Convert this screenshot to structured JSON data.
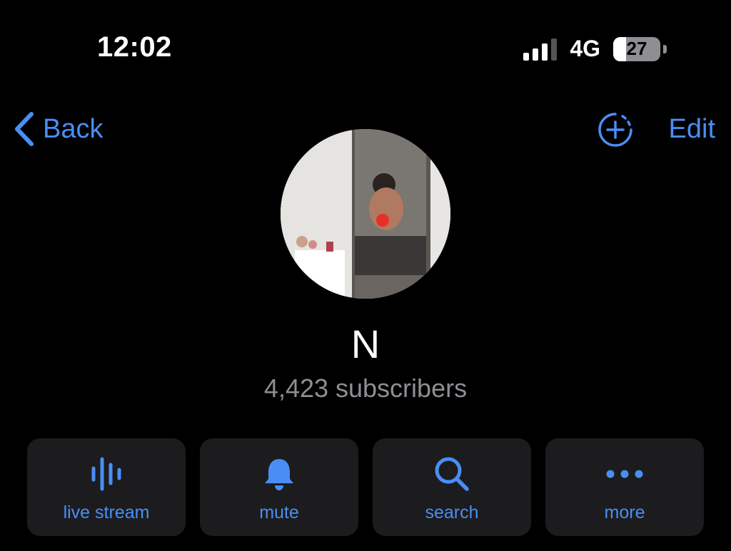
{
  "status_bar": {
    "time": "12:02",
    "network": "4G",
    "battery": "27",
    "battery_level": 0.27
  },
  "nav": {
    "back_label": "Back",
    "edit_label": "Edit"
  },
  "channel": {
    "name": "N",
    "subscribers": "4,423 subscribers"
  },
  "actions": [
    {
      "label": "live stream",
      "icon": "live-stream-icon"
    },
    {
      "label": "mute",
      "icon": "bell-icon"
    },
    {
      "label": "search",
      "icon": "search-icon"
    },
    {
      "label": "more",
      "icon": "ellipsis-icon"
    }
  ],
  "colors": {
    "accent": "#4a8ef5",
    "background": "#000000",
    "button_bg": "#1c1c1e",
    "secondary_text": "#8e8e93"
  }
}
